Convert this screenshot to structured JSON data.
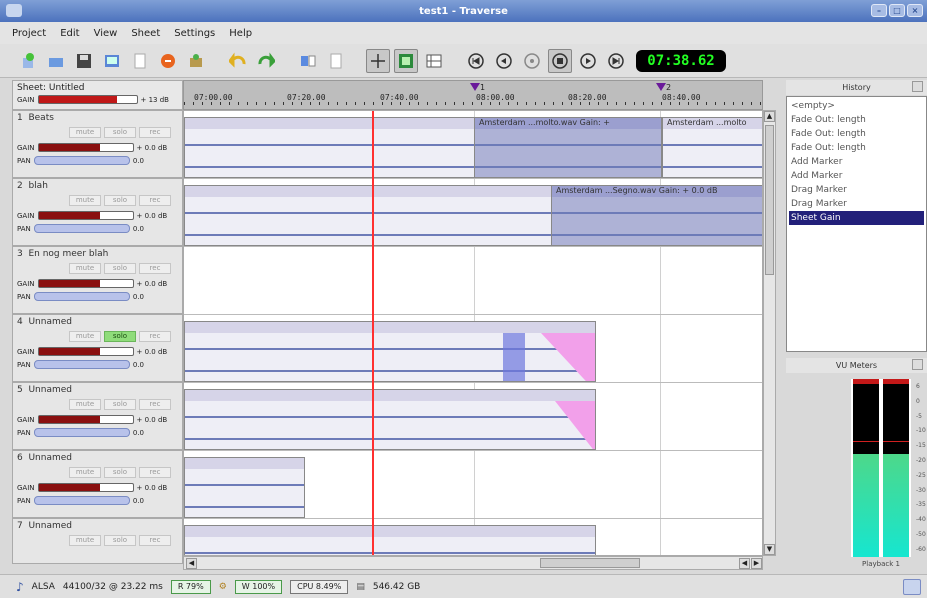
{
  "window": {
    "title": "test1 - Traverse"
  },
  "menu": [
    "Project",
    "Edit",
    "View",
    "Sheet",
    "Settings",
    "Help"
  ],
  "transport": {
    "clock": "07:38.62"
  },
  "sheet": {
    "name": "Sheet: Untitled",
    "gain_label": "GAIN",
    "gain_value": "+ 13 dB",
    "gain_fraction": 0.8
  },
  "ruler": {
    "ticks": [
      "07:00.00",
      "07:20.00",
      "07:40.00",
      "08:00.00",
      "08:20.00",
      "08:40.00"
    ],
    "markers": [
      "1",
      "2"
    ]
  },
  "tracks": [
    {
      "number": "1",
      "name": "Beats",
      "gain": "+ 0.0 dB",
      "pan": "0.0",
      "solo_on": false,
      "gain_fraction": 0.65
    },
    {
      "number": "2",
      "name": "blah",
      "gain": "+ 0.0 dB",
      "pan": "0.0",
      "solo_on": false,
      "gain_fraction": 0.65
    },
    {
      "number": "3",
      "name": "En nog meer blah",
      "gain": "+ 0.0 dB",
      "pan": "0.0",
      "solo_on": false,
      "gain_fraction": 0.65
    },
    {
      "number": "4",
      "name": "Unnamed",
      "gain": "+ 0.0 dB",
      "pan": "0.0",
      "solo_on": true,
      "gain_fraction": 0.65
    },
    {
      "number": "5",
      "name": "Unnamed",
      "gain": "+ 0.0 dB",
      "pan": "0.0",
      "solo_on": false,
      "gain_fraction": 0.65
    },
    {
      "number": "6",
      "name": "Unnamed",
      "gain": "+ 0.0 dB",
      "pan": "0.0",
      "solo_on": false,
      "gain_fraction": 0.65
    },
    {
      "number": "7",
      "name": "Unnamed",
      "gain": "",
      "pan": "",
      "solo_on": false,
      "gain_fraction": 0.65
    }
  ],
  "track_labels": {
    "mute": "mute",
    "solo": "solo",
    "rec": "rec",
    "gain": "GAIN",
    "pan": "PAN"
  },
  "clips": {
    "c1": "Amsterdam ...molto.wav  Gain: +",
    "c2": "Amsterdam ...molto",
    "c3": "Amsterdam ...Segno.wav  Gain: + 0.0 dB"
  },
  "history": {
    "title": "History",
    "items": [
      "<empty>",
      "Fade Out: length",
      "Fade Out: length",
      "Fade Out: length",
      "Add Marker",
      "Add Marker",
      "Drag Marker",
      "Drag Marker",
      "Sheet Gain"
    ],
    "selected_index": 8
  },
  "vu": {
    "title": "VU Meters",
    "scale": [
      "6",
      "0",
      "-5",
      "-10",
      "-15",
      "-20",
      "-25",
      "-30",
      "-35",
      "-40",
      "-50",
      "-60"
    ],
    "left_level": 0.58,
    "right_level": 0.58,
    "label": "Playback 1"
  },
  "status": {
    "driver": "ALSA",
    "rate": "44100/32 @ 23.22 ms",
    "read": "R 79%",
    "write": "W 100%",
    "cpu": "CPU 8.49%",
    "disk": "546.42 GB"
  }
}
